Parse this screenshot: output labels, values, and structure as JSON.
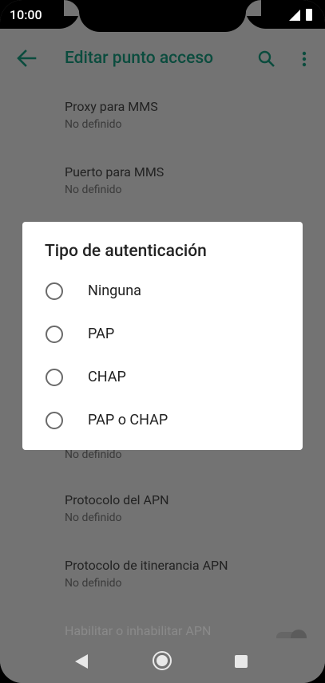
{
  "status": {
    "time": "10:00"
  },
  "appbar": {
    "title": "Editar punto acceso"
  },
  "list": [
    {
      "title": "Proxy para MMS",
      "subtitle": "No definido"
    },
    {
      "title": "Puerto para MMS",
      "subtitle": "No definido"
    },
    {
      "title": "",
      "subtitle": "No definido"
    },
    {
      "title": "Protocolo del APN",
      "subtitle": "No definido"
    },
    {
      "title": "Protocolo de itinerancia APN",
      "subtitle": "No definido"
    },
    {
      "title": "Habilitar o inhabilitar APN",
      "subtitle": ""
    }
  ],
  "dialog": {
    "title": "Tipo de autenticación",
    "options": [
      "Ninguna",
      "PAP",
      "CHAP",
      "PAP o CHAP"
    ]
  }
}
